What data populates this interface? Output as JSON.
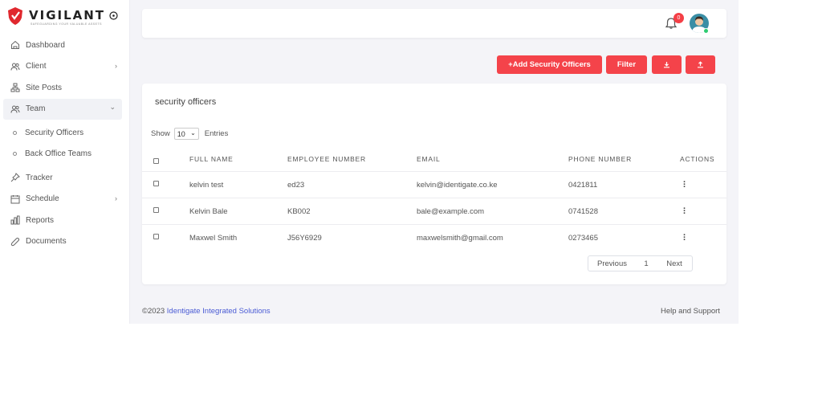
{
  "brand": {
    "name_left": "VIGILANT",
    "name_right": "O",
    "tagline": "SAFEGUARDING YOUR VALUABLE ASSETS",
    "accent": "#e0282e"
  },
  "sidebar": {
    "items": [
      {
        "label": "Dashboard",
        "icon": "home-icon"
      },
      {
        "label": "Client",
        "icon": "users-icon",
        "chevron": "›"
      },
      {
        "label": "Site Posts",
        "icon": "sitemap-icon"
      },
      {
        "label": "Team",
        "icon": "team-icon",
        "chevron": "⌄"
      },
      {
        "label": "Tracker",
        "icon": "pin-icon"
      },
      {
        "label": "Schedule",
        "icon": "calendar-icon",
        "chevron": "›"
      },
      {
        "label": "Reports",
        "icon": "bar-chart-icon"
      },
      {
        "label": "Documents",
        "icon": "paperclip-icon"
      }
    ],
    "team_sub": [
      "Security Officers",
      "Back Office Teams"
    ]
  },
  "topbar": {
    "notification_count": "0"
  },
  "actions": {
    "add_label": "+Add Security Officers",
    "filter_label": "Filter",
    "download_icon": "download-icon",
    "upload_icon": "upload-icon",
    "accent": "#f4434a"
  },
  "table": {
    "title": "security officers",
    "show_label": "Show",
    "page_size": "10",
    "entries_label": "Entries",
    "columns": [
      "FULL NAME",
      "EMPLOYEE NUMBER",
      "EMAIL",
      "PHONE NUMBER",
      "ACTIONS"
    ],
    "rows": [
      {
        "name": "kelvin test",
        "employee": "ed23",
        "email": "kelvin@identigate.co.ke",
        "phone": "0421811"
      },
      {
        "name": "Kelvin Bale",
        "employee": "KB002",
        "email": "bale@example.com",
        "phone": "0741528"
      },
      {
        "name": "Maxwel Smith",
        "employee": "J56Y6929",
        "email": "maxwelsmith@gmail.com",
        "phone": "0273465"
      }
    ],
    "pagination": {
      "previous": "Previous",
      "page": "1",
      "next": "Next"
    }
  },
  "footer": {
    "copyright": "©2023 ",
    "company": "Identigate Integrated Solutions",
    "help": "Help and Support"
  }
}
